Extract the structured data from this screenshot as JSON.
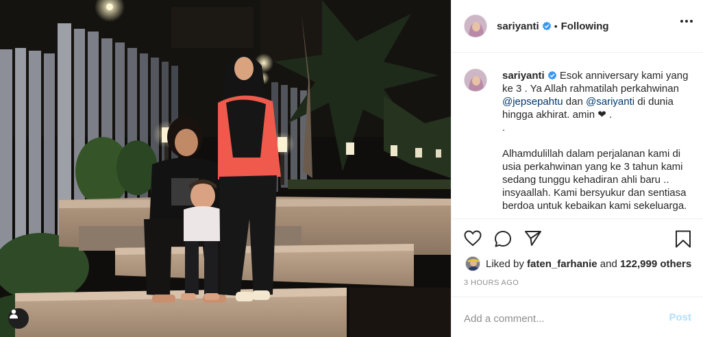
{
  "post": {
    "username": "sariyanti",
    "verified": true,
    "separator": "•",
    "follow_status": "Following",
    "more_options_icon": "ellipsis-icon"
  },
  "caption": {
    "username": "sariyanti",
    "line1": " Esok anniversary kami yang ke 3 . Ya Allah rahmatilah perkahwinan ",
    "mention1": "@jepsepahtu",
    "mid": " dan ",
    "mention2": "@sariyanti",
    "line2": " di dunia hingga akhirat. amin ❤ .\n.\n\nAlhamdulillah dalam perjalanan kami di usia perkahwinan yang ke 3 tahun kami sedang tunggu kehadiran ahli baru .. insyaallah. Kami bersyukur dan sentiasa berdoa untuk kebaikan kami sekeluarga."
  },
  "actions": {
    "like_icon": "heart-icon",
    "comment_icon": "comment-icon",
    "share_icon": "paper-plane-icon",
    "save_icon": "bookmark-icon"
  },
  "likes": {
    "prefix": "Liked by ",
    "first_liker": "faten_farhanie",
    "conjunction": " and ",
    "others": "122,999 others"
  },
  "timestamp": "3 HOURS AGO",
  "comment": {
    "placeholder": "Add a comment...",
    "post_label": "Post"
  },
  "colors": {
    "verified_badge": "#3897f0",
    "mention": "#00376b",
    "post_disabled": "#b2dffc",
    "muted": "#8e8e8e"
  }
}
